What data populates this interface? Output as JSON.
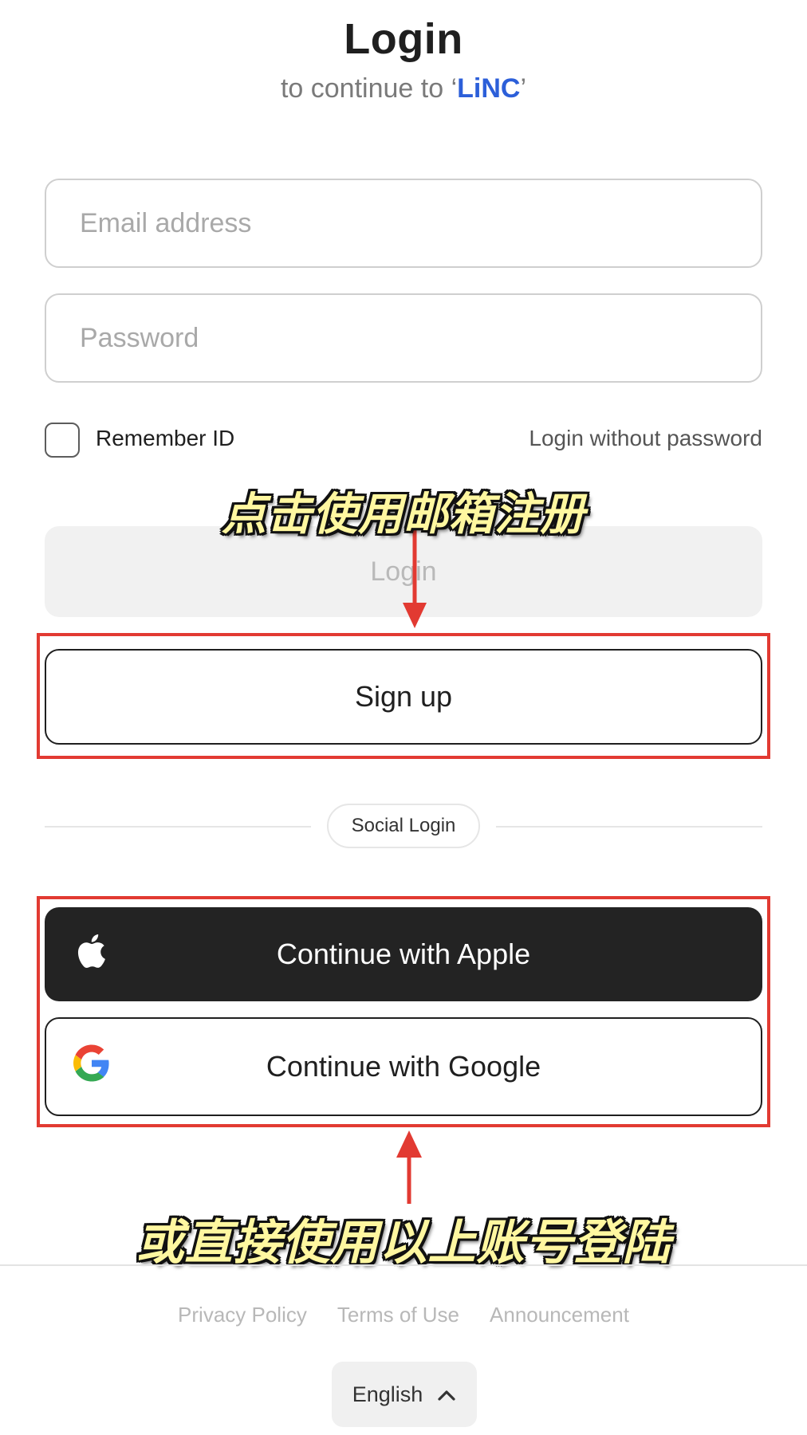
{
  "header": {
    "title": "Login",
    "subtitle_prefix": "to continue to ‘",
    "brand": "LiNC",
    "subtitle_suffix": "’"
  },
  "form": {
    "email_placeholder": "Email address",
    "email_value": "",
    "password_placeholder": "Password",
    "password_value": "",
    "remember_label": "Remember ID",
    "remember_checked": false,
    "login_without_password": "Login without password",
    "login_button": "Login",
    "signup_button": "Sign up"
  },
  "social": {
    "divider_label": "Social Login",
    "apple_button": "Continue with Apple",
    "google_button": "Continue with Google",
    "apple_icon": "apple-logo-icon",
    "google_icon": "google-logo-icon"
  },
  "annotations": {
    "top": "点击使用邮箱注册",
    "bottom": "或直接使用以上账号登陆",
    "highlight_color": "#e23a32"
  },
  "footer": {
    "links": [
      "Privacy Policy",
      "Terms of Use",
      "Announcement"
    ],
    "language": "English",
    "language_icon": "chevron-up-icon"
  },
  "colors": {
    "brand": "#2c5fd9",
    "apple_bg": "#232323",
    "annotation_text": "#fff7a0"
  }
}
